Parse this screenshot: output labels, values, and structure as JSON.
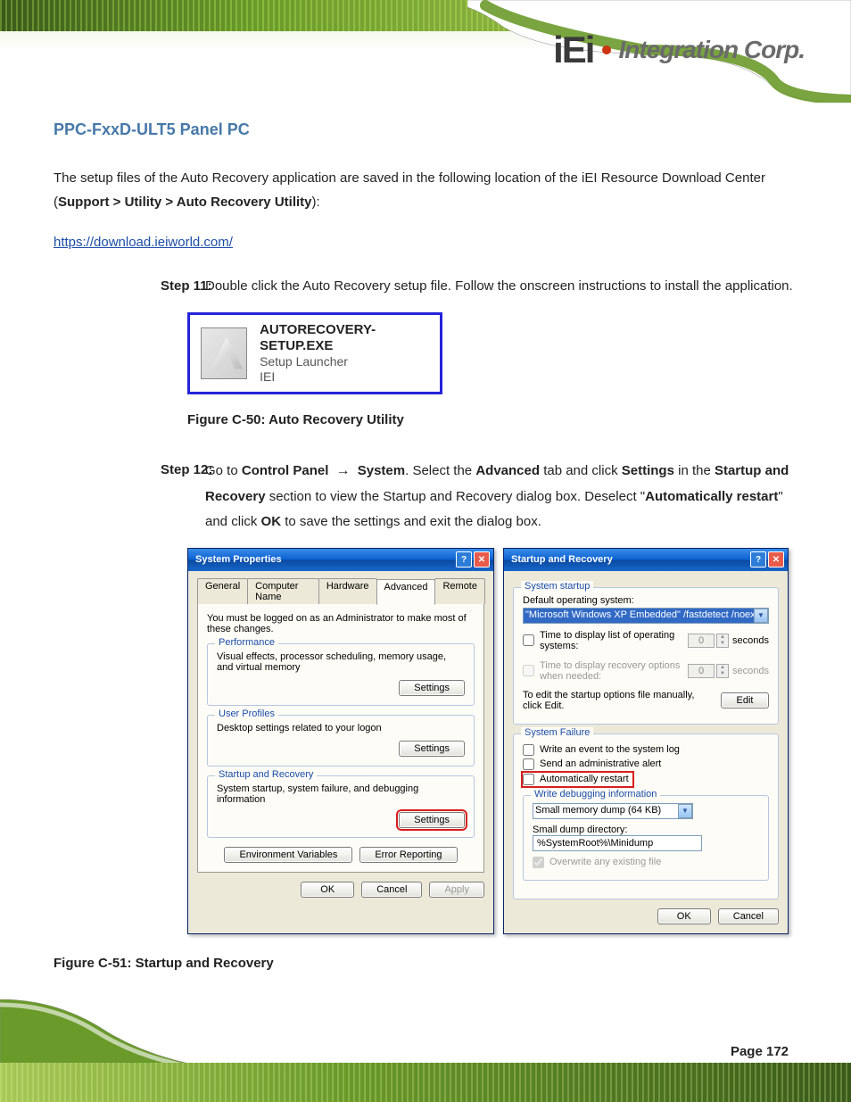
{
  "brand": {
    "logo": "iEi",
    "sub": "Integration Corp."
  },
  "doc": {
    "title": "PPC-FxxD-ULT5 Panel PC",
    "intro_pre": "The setup files of the Auto Recovery application are saved in the following location of the iEI Resource Download Center (",
    "intro_path": "Support > Utility > Auto Recovery Utility",
    "intro_post": "):"
  },
  "url": "https://download.ieiworld.com/",
  "step11": {
    "num": "Step 11:",
    "text": "Double click the Auto Recovery setup file. Follow the onscreen instructions to install the application."
  },
  "launcher": {
    "filename": "AUTORECOVERY-SETUP.EXE",
    "line2": "Setup Launcher",
    "line3": "IEI"
  },
  "fig50_caption": "Figure C-50: Auto Recovery Utility",
  "step12": {
    "num": "Step 12:",
    "a": "Go to ",
    "b": "Control Panel",
    "c": "System",
    "d": "Select the ",
    "e": "Advanced",
    "f": " tab and click ",
    "g": "Settings",
    "h": " in the ",
    "i": "Startup and Recovery",
    "j": " section to view the Startup and Recovery dialog box. Deselect \"",
    "k": "Automatically restart",
    "l": "\" and click ",
    "m": "OK",
    "n": " to save the settings and exit the dialog box."
  },
  "sysprop": {
    "title": "System Properties",
    "tabs": [
      "General",
      "Computer Name",
      "Hardware",
      "Advanced",
      "Remote"
    ],
    "note": "You must be logged on as an Administrator to make most of these changes.",
    "perf_legend": "Performance",
    "perf_text": "Visual effects, processor scheduling, memory usage, and virtual memory",
    "user_legend": "User Profiles",
    "user_text": "Desktop settings related to your logon",
    "sr_legend": "Startup and Recovery",
    "sr_text": "System startup, system failure, and debugging information",
    "btn_settings": "Settings",
    "btn_env": "Environment Variables",
    "btn_err": "Error Reporting",
    "btn_ok": "OK",
    "btn_cancel": "Cancel",
    "btn_apply": "Apply"
  },
  "startup": {
    "title": "Startup and Recovery",
    "sec_startup": "System startup",
    "lbl_default": "Default operating system:",
    "os_value": "\"Microsoft Windows XP Embedded\" /fastdetect /noexecute=Alwa",
    "chk_time_list": "Time to display list of operating systems:",
    "chk_time_rec": "Time to display recovery options when needed:",
    "seconds": "seconds",
    "edit_line": "To edit the startup options file manually, click Edit.",
    "btn_edit": "Edit",
    "sec_failure": "System Failure",
    "chk_event": "Write an event to the system log",
    "chk_admin": "Send an administrative alert",
    "chk_restart": "Automatically restart",
    "wdi_legend": "Write debugging information",
    "dump_sel": "Small memory dump (64 KB)",
    "lbl_dumpdir": "Small dump directory:",
    "dumpdir_val": "%SystemRoot%\\Minidump",
    "chk_overwrite": "Overwrite any existing file",
    "btn_ok": "OK",
    "btn_cancel": "Cancel",
    "spin_val": "0"
  },
  "fig51_caption": "Figure C-51: Startup and Recovery",
  "page_num": "Page 172"
}
